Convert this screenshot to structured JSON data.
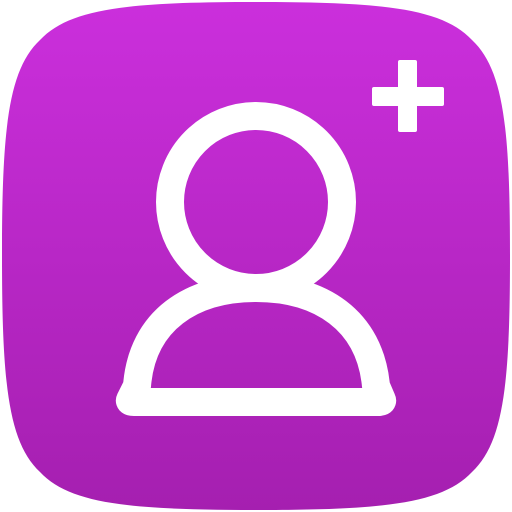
{
  "icon": {
    "name": "add-contact-icon",
    "glyph": "person-icon",
    "badge": "plus-icon"
  },
  "colors": {
    "gradient_top": "#cb2fdc",
    "gradient_bottom": "#a51fb0",
    "glyph": "#ffffff",
    "background": "#ffffff"
  }
}
